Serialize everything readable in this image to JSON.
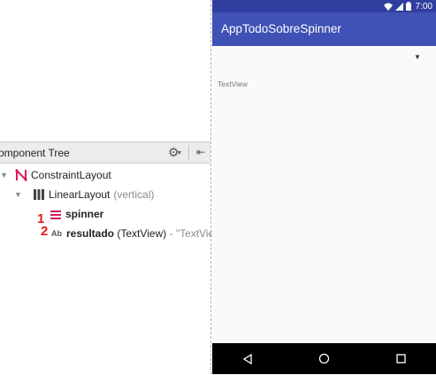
{
  "component_tree": {
    "title": "omponent Tree",
    "rows": [
      {
        "label": "ConstraintLayout",
        "secondary": ""
      },
      {
        "label": "LinearLayout",
        "secondary": "(vertical)"
      },
      {
        "label": "spinner",
        "secondary": ""
      },
      {
        "label": "resultado",
        "label_suffix": " (TextView)",
        "secondary": " - \"TextVie"
      }
    ],
    "annotations": [
      "1",
      "2"
    ],
    "icon_textview_text": "Ab"
  },
  "device": {
    "time": "7:00",
    "app_title": "AppTodoSobreSpinner",
    "textview_text": "TextView"
  },
  "colors": {
    "statusbar": "#303f9f",
    "appbar": "#3f51b5",
    "annotation": "#e41b17",
    "constraint_icon": "#d81b60"
  },
  "icons": [
    "gear-icon",
    "pin-icon",
    "constraint-layout-icon",
    "linear-layout-icon",
    "spinner-icon",
    "textview-icon",
    "wifi-icon",
    "signal-icon",
    "battery-icon",
    "back-icon",
    "home-icon",
    "recents-icon"
  ]
}
